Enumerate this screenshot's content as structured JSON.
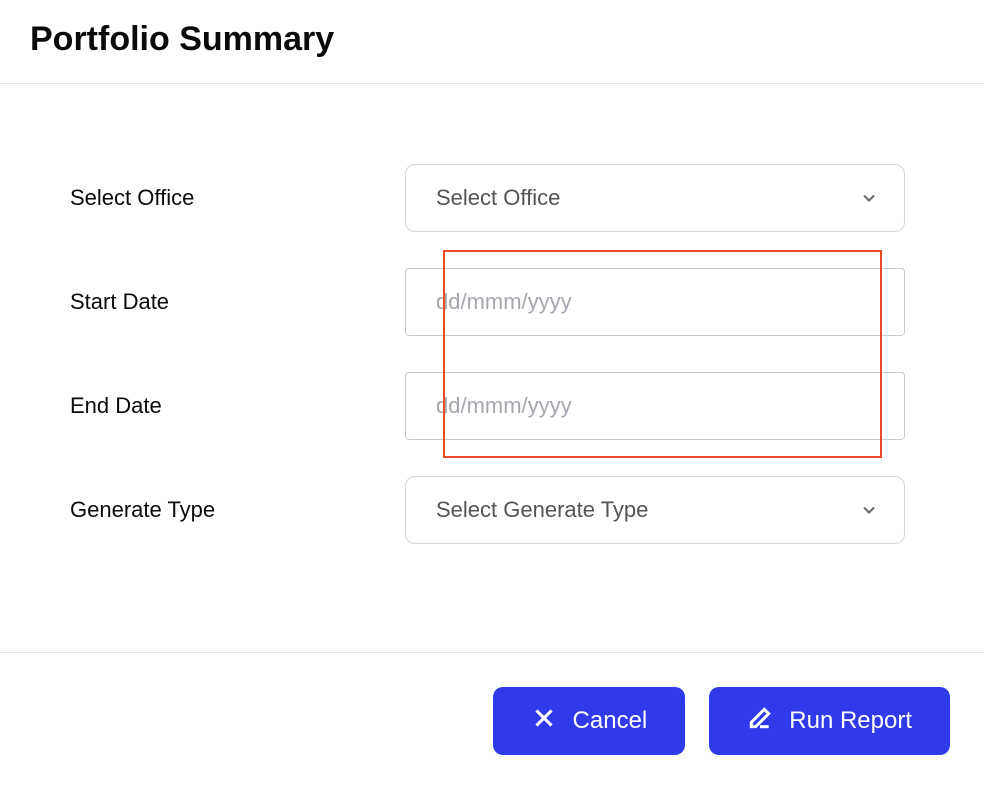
{
  "title": "Portfolio Summary",
  "form": {
    "office": {
      "label": "Select Office",
      "placeholder": "Select Office"
    },
    "start_date": {
      "label": "Start Date",
      "placeholder": "dd/mmm/yyyy"
    },
    "end_date": {
      "label": "End Date",
      "placeholder": "dd/mmm/yyyy"
    },
    "generate_type": {
      "label": "Generate Type",
      "placeholder": "Select Generate Type"
    }
  },
  "buttons": {
    "cancel": "Cancel",
    "run_report": "Run Report"
  }
}
